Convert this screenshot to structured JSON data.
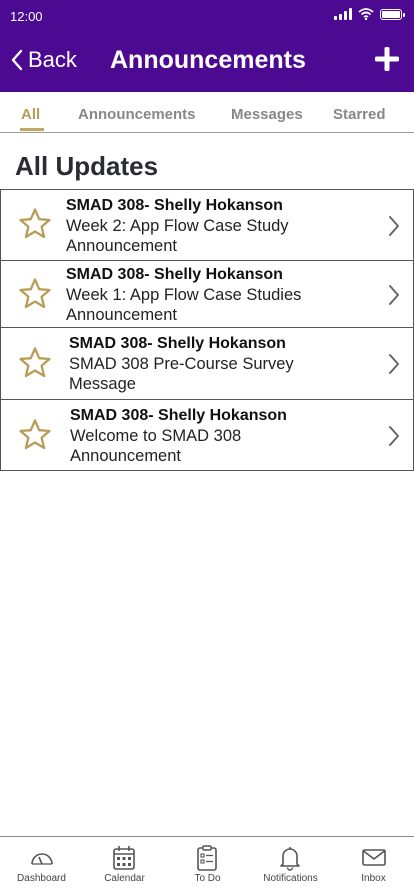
{
  "status": {
    "time": "12:00"
  },
  "header": {
    "back_label": "Back",
    "title": "Announcements"
  },
  "tabs": [
    {
      "label": "All",
      "active": true
    },
    {
      "label": "Announcements",
      "active": false
    },
    {
      "label": "Messages",
      "active": false
    },
    {
      "label": "Starred",
      "active": false
    }
  ],
  "section_title": "All Updates",
  "items": [
    {
      "line1": "SMAD 308- Shelly Hokanson",
      "line2": "Week 2: App Flow Case Study",
      "line3": "Announcement"
    },
    {
      "line1": "SMAD 308- Shelly Hokanson",
      "line2": "Week 1: App Flow Case Studies",
      "line3": "Announcement"
    },
    {
      "line1": "SMAD 308- Shelly Hokanson",
      "line2": "SMAD 308 Pre-Course Survey",
      "line3": "Message"
    },
    {
      "line1": "SMAD 308- Shelly Hokanson",
      "line2": "Welcome to SMAD 308",
      "line3": "Announcement"
    }
  ],
  "tabbar": [
    {
      "label": "Dashboard",
      "icon": "gauge-icon"
    },
    {
      "label": "Calendar",
      "icon": "calendar-icon"
    },
    {
      "label": "To Do",
      "icon": "clipboard-icon"
    },
    {
      "label": "Notifications",
      "icon": "bell-icon"
    },
    {
      "label": "Inbox",
      "icon": "envelope-icon"
    }
  ],
  "colors": {
    "header": "#4b0a91",
    "accent": "#b79d57",
    "star": "#b79d57"
  }
}
